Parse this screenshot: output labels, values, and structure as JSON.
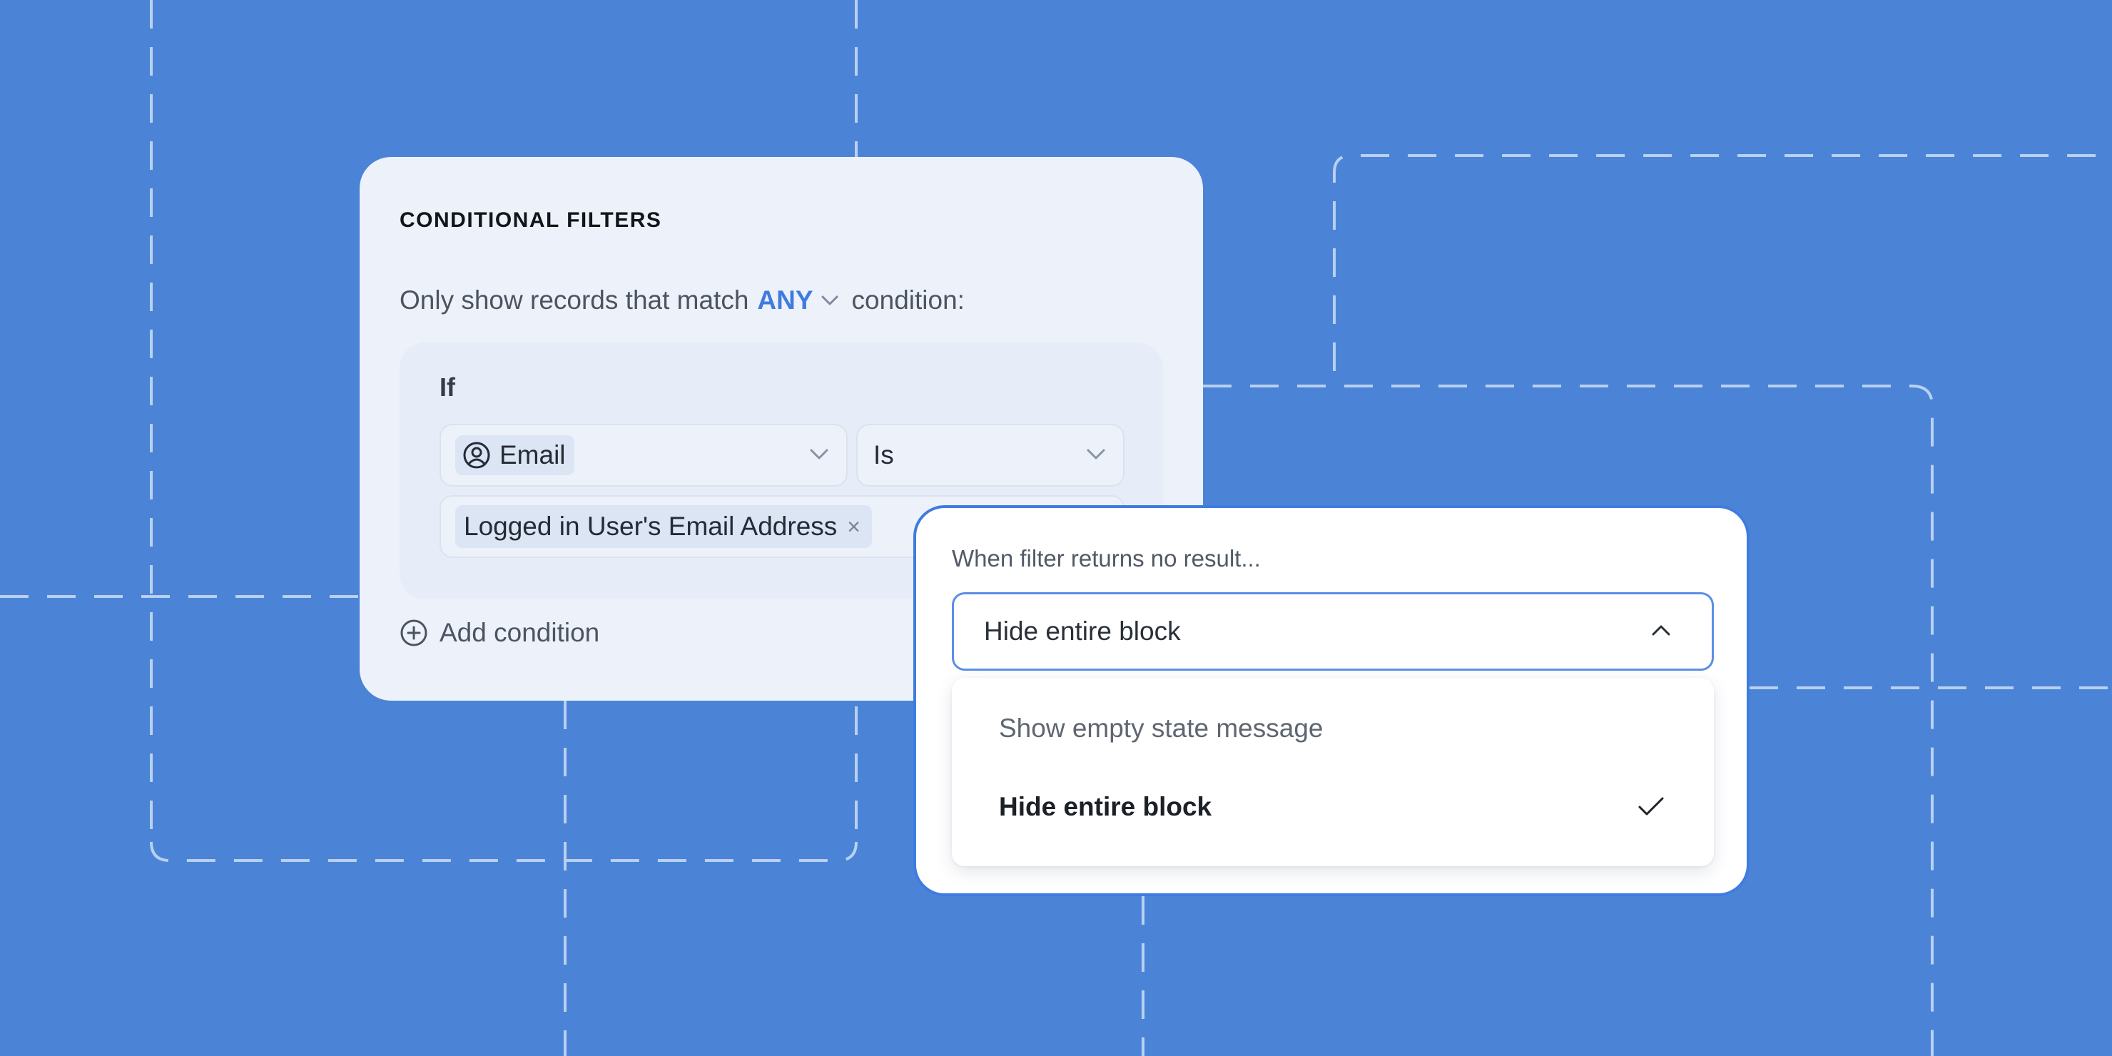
{
  "filters": {
    "title": "CONDITIONAL FILTERS",
    "match_prefix": "Only show records that match",
    "match_mode": "ANY",
    "match_suffix": "condition:",
    "condition": {
      "if_label": "If",
      "field": {
        "label": "Email",
        "icon": "user-circle-icon"
      },
      "operator": "Is",
      "value": "Logged in User's Email Address"
    },
    "add_condition_label": "Add condition"
  },
  "no_result": {
    "label": "When filter returns no result...",
    "selected": "Hide entire block",
    "options": [
      {
        "label": "Show empty state message",
        "selected": false
      },
      {
        "label": "Hide entire block",
        "selected": true
      }
    ]
  },
  "colors": {
    "background": "#4b84d6",
    "accent": "#3f7be0",
    "card": "#edf1f9"
  }
}
